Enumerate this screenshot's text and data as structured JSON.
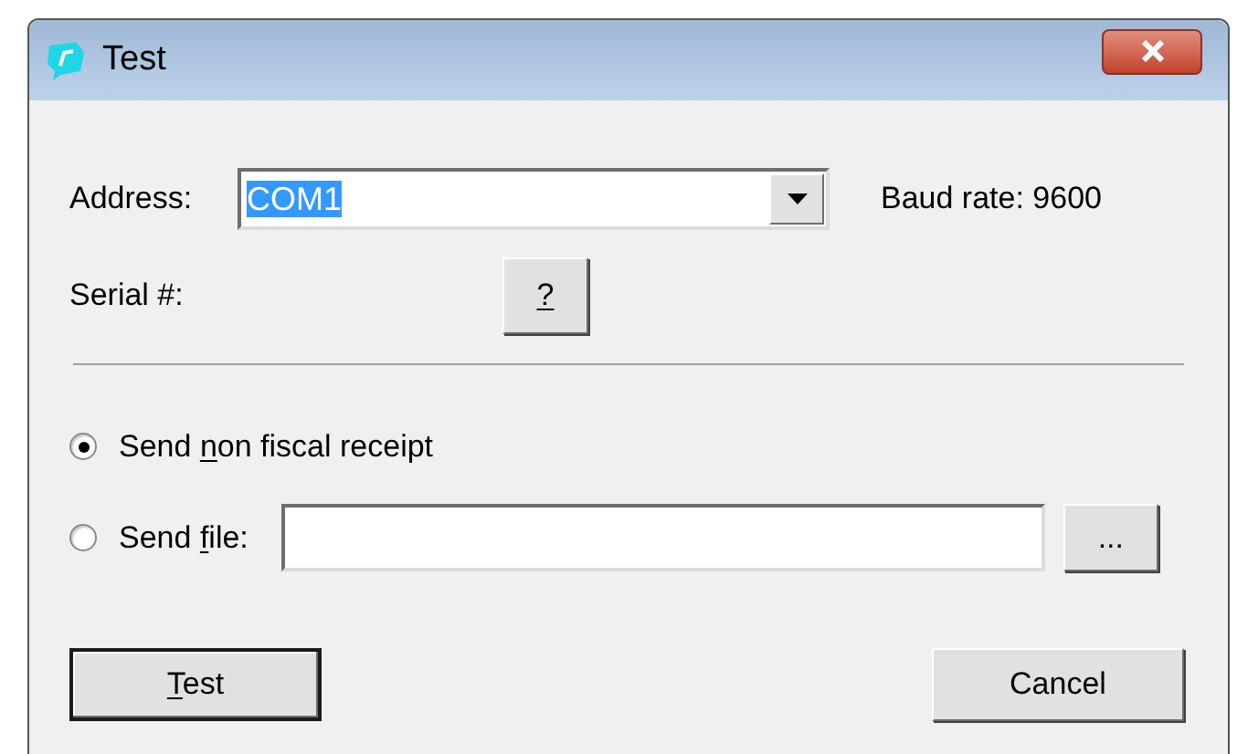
{
  "window": {
    "title": "Test"
  },
  "address": {
    "label": "Address:",
    "value": "COM1",
    "selected_text": true
  },
  "baud_rate": "Baud rate: 9600",
  "serial": {
    "label": "Serial #:",
    "button": {
      "key": "?"
    }
  },
  "options": [
    {
      "label": {
        "before": "Send ",
        "key": "n",
        "after": "on fiscal receipt"
      },
      "selected": true,
      "kind": "plain"
    },
    {
      "label": {
        "before": "Send ",
        "key": "f",
        "after": "ile:"
      },
      "selected": false,
      "kind": "file",
      "browse": "..."
    }
  ],
  "buttons": [
    {
      "label": {
        "key": "T",
        "after": "est"
      },
      "default": true
    },
    {
      "label": {
        "before": "Cancel"
      },
      "default": false
    }
  ]
}
